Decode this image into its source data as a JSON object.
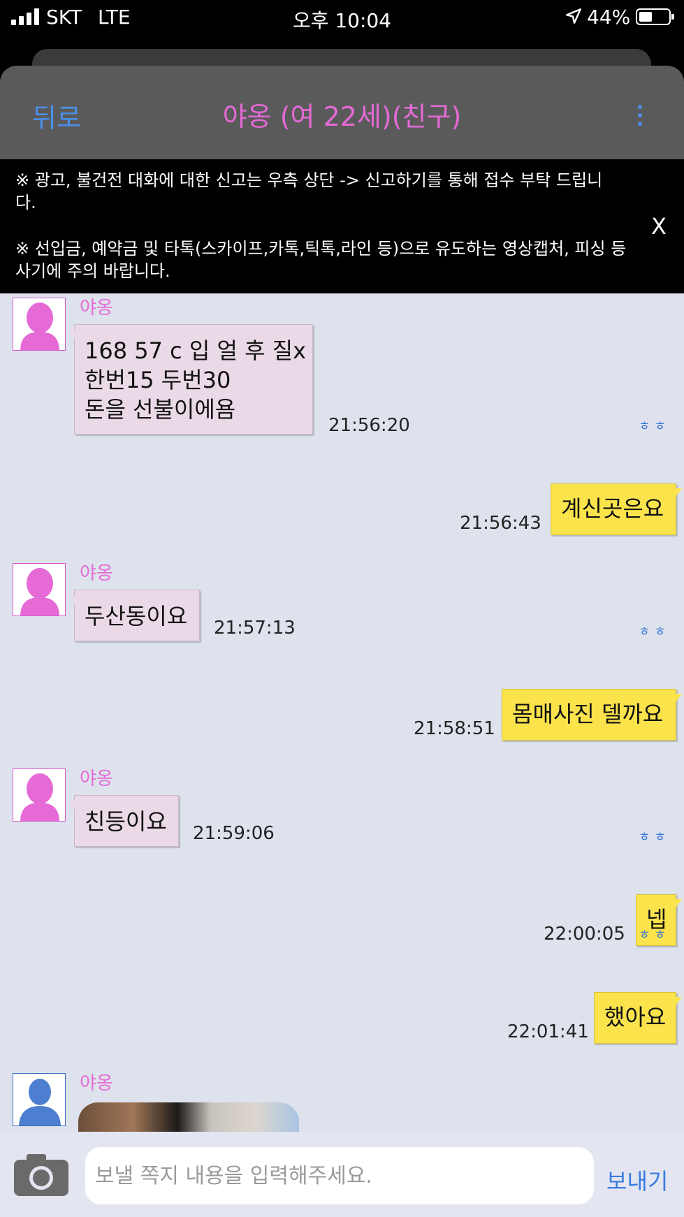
{
  "status_bar": {
    "carrier": "SKT",
    "network": "LTE",
    "time": "오후 10:04",
    "battery": "44%",
    "battery_level": 0.44
  },
  "header": {
    "back_label": "뒤로",
    "title": "야옹 (여 22세)(친구)",
    "more_icon": "kebab-menu-icon"
  },
  "notice": {
    "line1": "※ 광고, 불건전 대화에 대한 신고는 우측 상단 -> 신고하기를 통해 접수 부탁 드립니다.",
    "line2": "※ 선입금, 예약금 및 타톡(스카이프,카톡,틱톡,라인 등)으로 유도하는 영상캡처, 피싱 등 사기에 주의 바랍니다.",
    "close_label": "X"
  },
  "messages": [
    {
      "direction": "in",
      "sender": "야옹",
      "text": "168 57 c 입 얼 후 질x\n한번15 두번30\n돈을 선불이에욤",
      "time": "21:56:20"
    },
    {
      "direction": "out",
      "read": "ㅎㅎ",
      "text": "계신곳은요",
      "time": "21:56:43"
    },
    {
      "direction": "in",
      "sender": "야옹",
      "text": "두산동이요",
      "time": "21:57:13"
    },
    {
      "direction": "out",
      "read": "ㅎㅎ",
      "text": "몸매사진 델까요",
      "time": "21:58:51"
    },
    {
      "direction": "in",
      "sender": "야옹",
      "text": "친등이요",
      "time": "21:59:06"
    },
    {
      "direction": "out",
      "read": "ㅎㅎ",
      "text": "넵",
      "time": "22:00:05"
    },
    {
      "direction": "out",
      "read": "ㅎㅎ",
      "text": "했아요",
      "time": "22:01:41"
    },
    {
      "direction": "in",
      "sender": "야옹",
      "type": "photo"
    }
  ],
  "input_bar": {
    "camera_icon": "camera-icon",
    "placeholder": "보낼 쪽지 내용을 입력해주세요.",
    "send_label": "보내기"
  },
  "colors": {
    "accent_pink": "#e56ad6",
    "accent_blue": "#4a8fe8",
    "outgoing_bubble": "#fbe34c",
    "incoming_bubble": "#ead9e6",
    "chat_background": "#dde2ec"
  }
}
